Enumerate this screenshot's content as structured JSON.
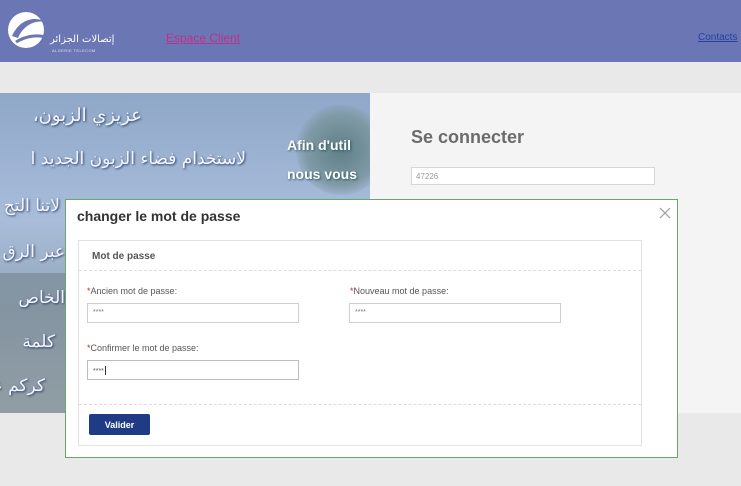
{
  "header": {
    "logo_text": "إتصالات الجزائر",
    "logo_sub": "ALGERIE TELECOM",
    "nav_espace_client": "Espace Client",
    "nav_contact": "Contacts"
  },
  "hero": {
    "arabic_lines": [
      "عزيزي الزبون،",
      "لاستخدام فضاء الزبون الجديد ا",
      "لاتنا التج",
      "عبر الرق",
      "الخاص",
      "كلمة",
      "كركم عل"
    ],
    "french_lines": [
      "Afin d'util",
      "nous vous"
    ]
  },
  "login": {
    "title": "Se connecter",
    "username_value": "47226"
  },
  "modal": {
    "title": "changer le mot de passe",
    "section_legend": "Mot de passe",
    "required_mark": "*",
    "old_password_label": "Ancien mot de passe:",
    "old_password_value": "****",
    "new_password_label": "Nouveau mot de passe:",
    "new_password_value": "****",
    "confirm_password_label": "Confirmer le mot de passe:",
    "confirm_password_value": "****",
    "submit_label": "Valider"
  },
  "colors": {
    "header_bg": "#6a77b4",
    "button_bg": "#1f3b86",
    "modal_border": "#6aa86a",
    "required": "#c62828"
  }
}
